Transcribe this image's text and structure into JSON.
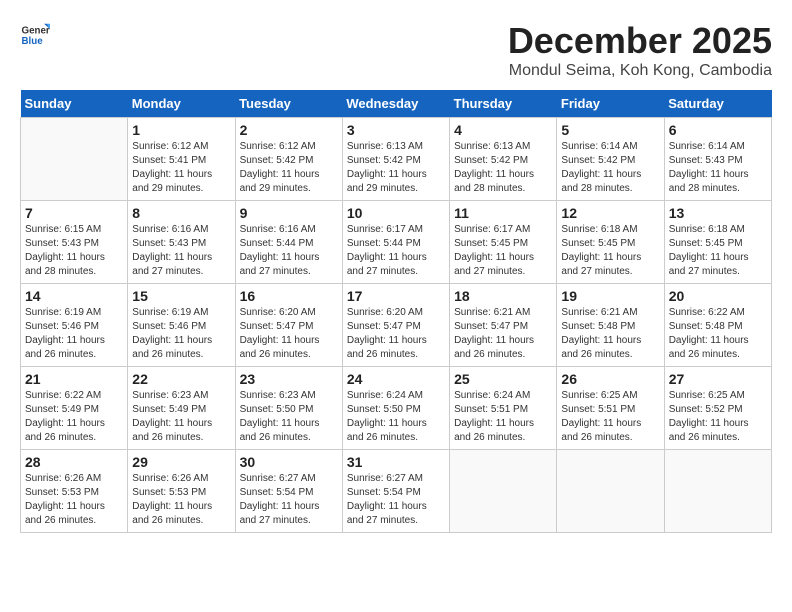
{
  "header": {
    "logo_general": "General",
    "logo_blue": "Blue",
    "title": "December 2025",
    "subtitle": "Mondul Seima, Koh Kong, Cambodia"
  },
  "days_of_week": [
    "Sunday",
    "Monday",
    "Tuesday",
    "Wednesday",
    "Thursday",
    "Friday",
    "Saturday"
  ],
  "weeks": [
    [
      {
        "day": "",
        "sunrise": "",
        "sunset": "",
        "daylight": ""
      },
      {
        "day": "1",
        "sunrise": "Sunrise: 6:12 AM",
        "sunset": "Sunset: 5:41 PM",
        "daylight": "Daylight: 11 hours and 29 minutes."
      },
      {
        "day": "2",
        "sunrise": "Sunrise: 6:12 AM",
        "sunset": "Sunset: 5:42 PM",
        "daylight": "Daylight: 11 hours and 29 minutes."
      },
      {
        "day": "3",
        "sunrise": "Sunrise: 6:13 AM",
        "sunset": "Sunset: 5:42 PM",
        "daylight": "Daylight: 11 hours and 29 minutes."
      },
      {
        "day": "4",
        "sunrise": "Sunrise: 6:13 AM",
        "sunset": "Sunset: 5:42 PM",
        "daylight": "Daylight: 11 hours and 28 minutes."
      },
      {
        "day": "5",
        "sunrise": "Sunrise: 6:14 AM",
        "sunset": "Sunset: 5:42 PM",
        "daylight": "Daylight: 11 hours and 28 minutes."
      },
      {
        "day": "6",
        "sunrise": "Sunrise: 6:14 AM",
        "sunset": "Sunset: 5:43 PM",
        "daylight": "Daylight: 11 hours and 28 minutes."
      }
    ],
    [
      {
        "day": "7",
        "sunrise": "Sunrise: 6:15 AM",
        "sunset": "Sunset: 5:43 PM",
        "daylight": "Daylight: 11 hours and 28 minutes."
      },
      {
        "day": "8",
        "sunrise": "Sunrise: 6:16 AM",
        "sunset": "Sunset: 5:43 PM",
        "daylight": "Daylight: 11 hours and 27 minutes."
      },
      {
        "day": "9",
        "sunrise": "Sunrise: 6:16 AM",
        "sunset": "Sunset: 5:44 PM",
        "daylight": "Daylight: 11 hours and 27 minutes."
      },
      {
        "day": "10",
        "sunrise": "Sunrise: 6:17 AM",
        "sunset": "Sunset: 5:44 PM",
        "daylight": "Daylight: 11 hours and 27 minutes."
      },
      {
        "day": "11",
        "sunrise": "Sunrise: 6:17 AM",
        "sunset": "Sunset: 5:45 PM",
        "daylight": "Daylight: 11 hours and 27 minutes."
      },
      {
        "day": "12",
        "sunrise": "Sunrise: 6:18 AM",
        "sunset": "Sunset: 5:45 PM",
        "daylight": "Daylight: 11 hours and 27 minutes."
      },
      {
        "day": "13",
        "sunrise": "Sunrise: 6:18 AM",
        "sunset": "Sunset: 5:45 PM",
        "daylight": "Daylight: 11 hours and 27 minutes."
      }
    ],
    [
      {
        "day": "14",
        "sunrise": "Sunrise: 6:19 AM",
        "sunset": "Sunset: 5:46 PM",
        "daylight": "Daylight: 11 hours and 26 minutes."
      },
      {
        "day": "15",
        "sunrise": "Sunrise: 6:19 AM",
        "sunset": "Sunset: 5:46 PM",
        "daylight": "Daylight: 11 hours and 26 minutes."
      },
      {
        "day": "16",
        "sunrise": "Sunrise: 6:20 AM",
        "sunset": "Sunset: 5:47 PM",
        "daylight": "Daylight: 11 hours and 26 minutes."
      },
      {
        "day": "17",
        "sunrise": "Sunrise: 6:20 AM",
        "sunset": "Sunset: 5:47 PM",
        "daylight": "Daylight: 11 hours and 26 minutes."
      },
      {
        "day": "18",
        "sunrise": "Sunrise: 6:21 AM",
        "sunset": "Sunset: 5:47 PM",
        "daylight": "Daylight: 11 hours and 26 minutes."
      },
      {
        "day": "19",
        "sunrise": "Sunrise: 6:21 AM",
        "sunset": "Sunset: 5:48 PM",
        "daylight": "Daylight: 11 hours and 26 minutes."
      },
      {
        "day": "20",
        "sunrise": "Sunrise: 6:22 AM",
        "sunset": "Sunset: 5:48 PM",
        "daylight": "Daylight: 11 hours and 26 minutes."
      }
    ],
    [
      {
        "day": "21",
        "sunrise": "Sunrise: 6:22 AM",
        "sunset": "Sunset: 5:49 PM",
        "daylight": "Daylight: 11 hours and 26 minutes."
      },
      {
        "day": "22",
        "sunrise": "Sunrise: 6:23 AM",
        "sunset": "Sunset: 5:49 PM",
        "daylight": "Daylight: 11 hours and 26 minutes."
      },
      {
        "day": "23",
        "sunrise": "Sunrise: 6:23 AM",
        "sunset": "Sunset: 5:50 PM",
        "daylight": "Daylight: 11 hours and 26 minutes."
      },
      {
        "day": "24",
        "sunrise": "Sunrise: 6:24 AM",
        "sunset": "Sunset: 5:50 PM",
        "daylight": "Daylight: 11 hours and 26 minutes."
      },
      {
        "day": "25",
        "sunrise": "Sunrise: 6:24 AM",
        "sunset": "Sunset: 5:51 PM",
        "daylight": "Daylight: 11 hours and 26 minutes."
      },
      {
        "day": "26",
        "sunrise": "Sunrise: 6:25 AM",
        "sunset": "Sunset: 5:51 PM",
        "daylight": "Daylight: 11 hours and 26 minutes."
      },
      {
        "day": "27",
        "sunrise": "Sunrise: 6:25 AM",
        "sunset": "Sunset: 5:52 PM",
        "daylight": "Daylight: 11 hours and 26 minutes."
      }
    ],
    [
      {
        "day": "28",
        "sunrise": "Sunrise: 6:26 AM",
        "sunset": "Sunset: 5:53 PM",
        "daylight": "Daylight: 11 hours and 26 minutes."
      },
      {
        "day": "29",
        "sunrise": "Sunrise: 6:26 AM",
        "sunset": "Sunset: 5:53 PM",
        "daylight": "Daylight: 11 hours and 26 minutes."
      },
      {
        "day": "30",
        "sunrise": "Sunrise: 6:27 AM",
        "sunset": "Sunset: 5:54 PM",
        "daylight": "Daylight: 11 hours and 27 minutes."
      },
      {
        "day": "31",
        "sunrise": "Sunrise: 6:27 AM",
        "sunset": "Sunset: 5:54 PM",
        "daylight": "Daylight: 11 hours and 27 minutes."
      },
      {
        "day": "",
        "sunrise": "",
        "sunset": "",
        "daylight": ""
      },
      {
        "day": "",
        "sunrise": "",
        "sunset": "",
        "daylight": ""
      },
      {
        "day": "",
        "sunrise": "",
        "sunset": "",
        "daylight": ""
      }
    ]
  ]
}
